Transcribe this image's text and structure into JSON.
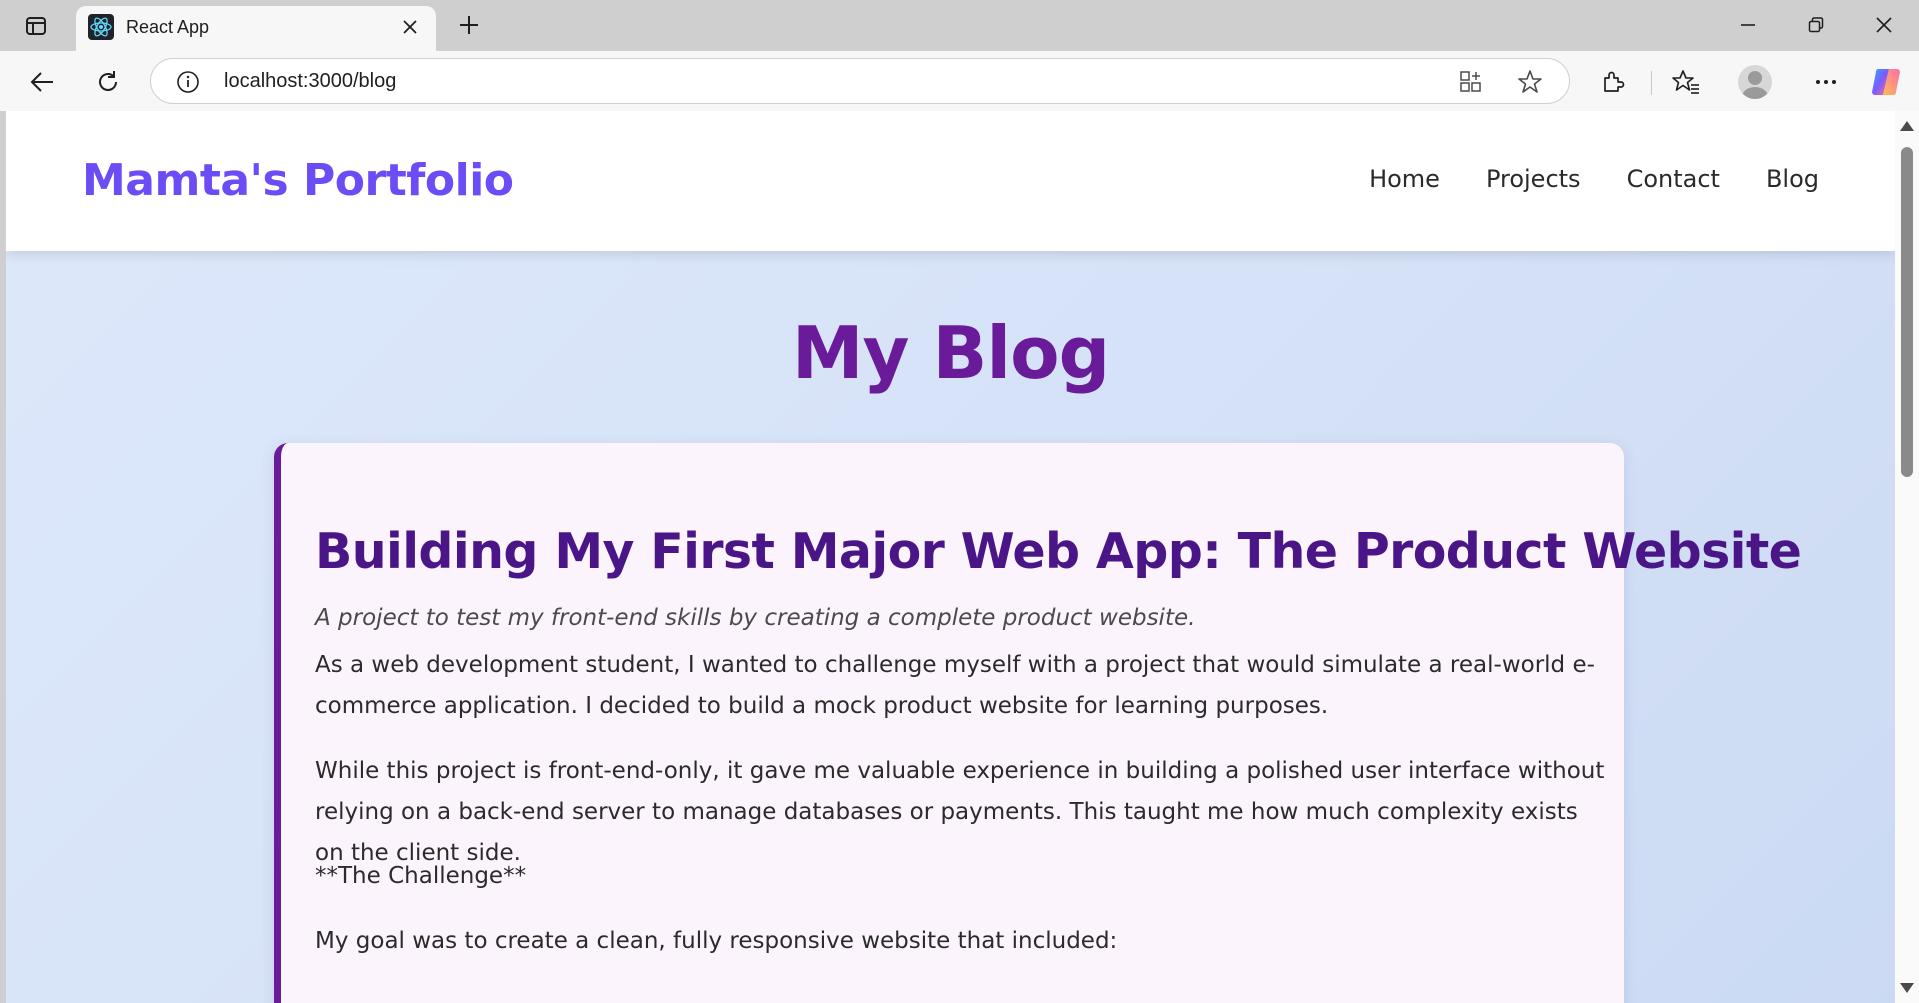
{
  "browser": {
    "tab_title": "React App",
    "url": "localhost:3000/blog"
  },
  "site": {
    "brand": "Mamta's Portfolio",
    "nav": [
      "Home",
      "Projects",
      "Contact",
      "Blog"
    ]
  },
  "page": {
    "title": "My Blog"
  },
  "post": {
    "title": "Building My First Major Web App: The Product Website",
    "subtitle": "A project to test my front-end skills by creating a complete product website.",
    "paragraphs": [
      "As a web development student, I wanted to challenge myself with a project that would simulate a real-world e-commerce application. I decided to build a mock product website for learning purposes.",
      "While this project is front-end-only, it gave me valuable experience in building a polished user interface without relying on a back-end server to manage databases or payments. This taught me how much complexity exists on the client side.",
      "**The Challenge**",
      "My goal was to create a clean, fully responsive website that included:"
    ]
  },
  "icons": {
    "sidebar": "sidebar-icon",
    "favicon": "react-icon",
    "tab_close": "close-icon",
    "new_tab": "plus-icon",
    "minimize": "minimize-icon",
    "restore": "restore-icon",
    "close_window": "close-icon",
    "back": "back-arrow-icon",
    "reload": "reload-icon",
    "site_info": "info-icon",
    "app_available": "apps-icon",
    "favorite": "star-icon",
    "extensions": "puzzle-icon",
    "favorites": "favorites-icon",
    "profile": "profile-icon",
    "more": "more-icon",
    "copilot": "copilot-icon"
  },
  "colors": {
    "brand": "#6c4cf5",
    "heading": "#6a1b9a",
    "post_title": "#4a1587",
    "card_accent": "#6a1b9a",
    "card_bg": "#fcf4fc"
  }
}
